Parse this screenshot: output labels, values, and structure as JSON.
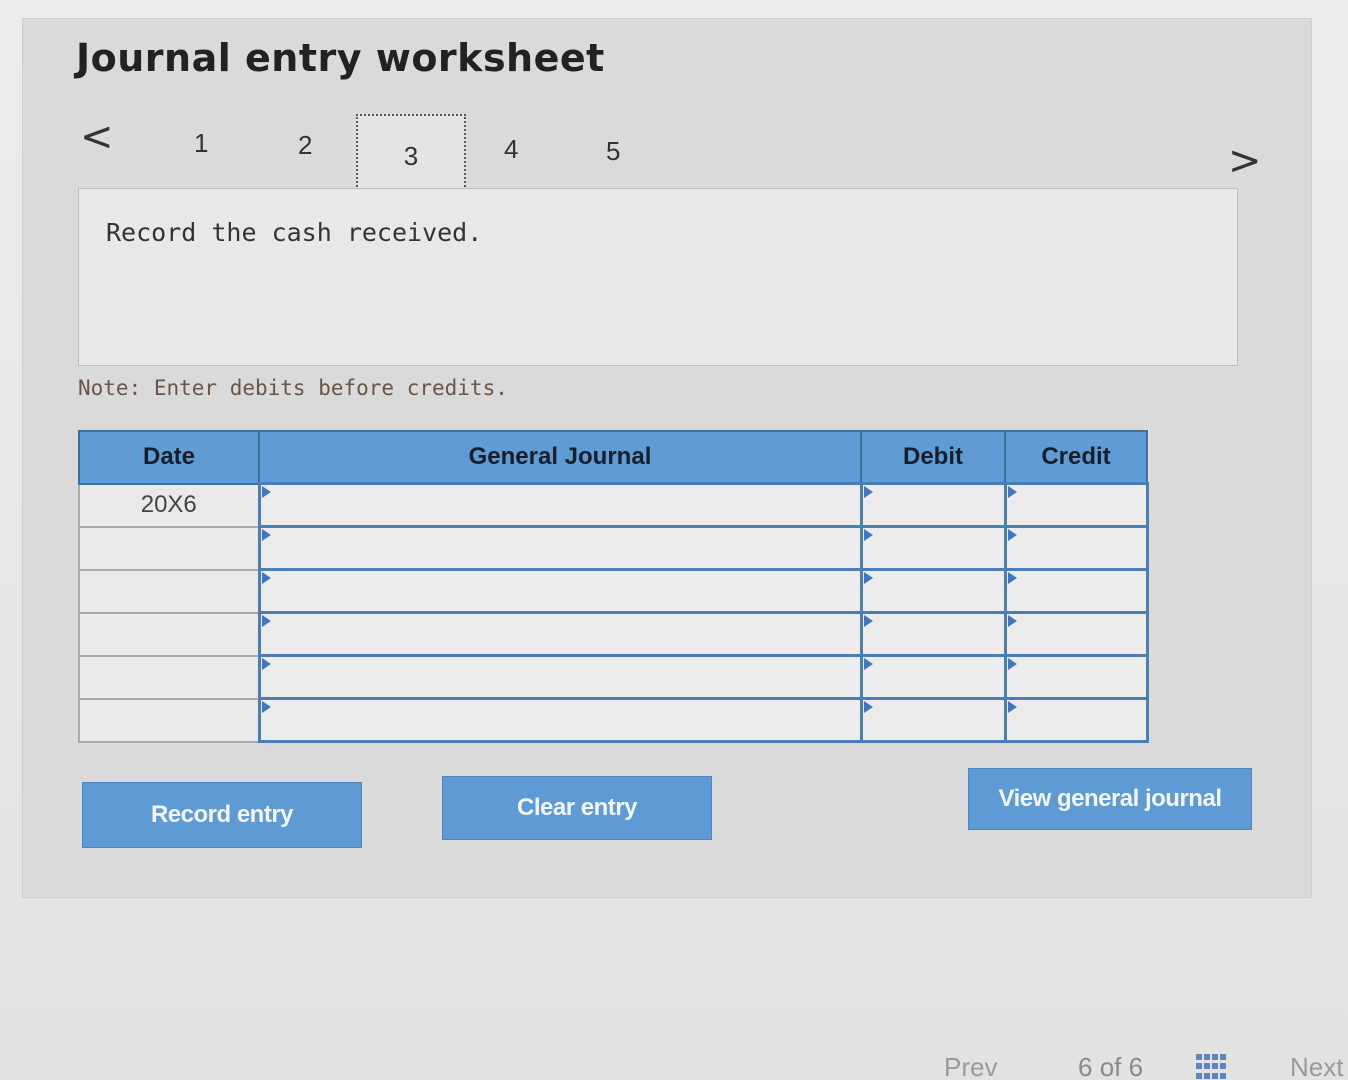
{
  "header": {
    "title": "Journal entry worksheet"
  },
  "stepper": {
    "prev_icon": "<",
    "next_icon": ">",
    "steps": [
      "1",
      "2",
      "3",
      "4",
      "5"
    ],
    "active_step": "3"
  },
  "instruction": {
    "text": "Record the cash received."
  },
  "note": {
    "text": "Note: Enter debits before credits."
  },
  "journal_table": {
    "headers": {
      "date": "Date",
      "account": "General Journal",
      "debit": "Debit",
      "credit": "Credit"
    },
    "rows": [
      {
        "date": "20X6",
        "account": "",
        "debit": "",
        "credit": ""
      },
      {
        "date": "",
        "account": "",
        "debit": "",
        "credit": ""
      },
      {
        "date": "",
        "account": "",
        "debit": "",
        "credit": ""
      },
      {
        "date": "",
        "account": "",
        "debit": "",
        "credit": ""
      },
      {
        "date": "",
        "account": "",
        "debit": "",
        "credit": ""
      },
      {
        "date": "",
        "account": "",
        "debit": "",
        "credit": ""
      }
    ]
  },
  "buttons": {
    "record": "Record entry",
    "clear": "Clear entry",
    "view": "View general journal"
  },
  "footer": {
    "prev": "Prev",
    "page_current": "6",
    "page_of": "of",
    "page_total": "6",
    "next": "Next",
    "grid_icon": "grid-icon"
  },
  "colors": {
    "accent": "#5e9ad3",
    "header_fill": "#5f9bd4",
    "input_border": "#4a7fb5",
    "note_text": "#6a5648"
  }
}
